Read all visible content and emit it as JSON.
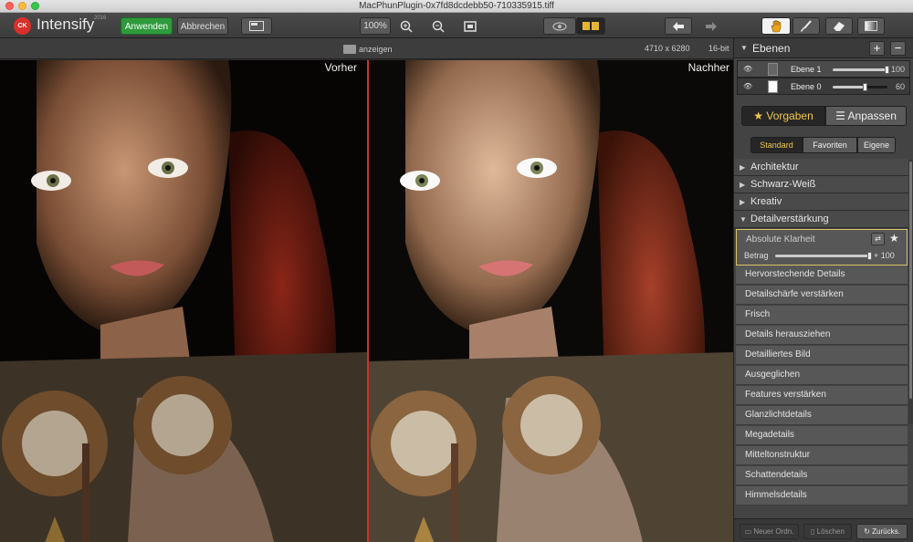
{
  "window": {
    "title": "MacPhunPlugin-0x7fd8dcdebb50-710335915.tiff"
  },
  "app": {
    "badge": "CK",
    "name": "Intensify",
    "year": "2016"
  },
  "toolbar": {
    "apply_label": "Anwenden",
    "cancel_label": "Abbrechen",
    "zoom_label": "100%"
  },
  "infobar": {
    "show_label": "anzeigen",
    "dimensions": "4710 x 6280",
    "bit_depth": "16-bit"
  },
  "preview": {
    "before_label": "Vorher",
    "after_label": "Nachher"
  },
  "layers": {
    "title": "Ebenen",
    "items": [
      {
        "name": "Ebene 1",
        "opacity": "100",
        "level": 1.0
      },
      {
        "name": "Ebene 0",
        "opacity": "60",
        "level": 0.6
      }
    ]
  },
  "tabs": {
    "presets": "Vorgaben",
    "adjust": "Anpassen"
  },
  "subtabs": {
    "standard": "Standard",
    "favorites": "Favoriten",
    "own": "Eigene"
  },
  "categories": [
    {
      "label": "Architektur",
      "expanded": false
    },
    {
      "label": "Schwarz-Weiß",
      "expanded": false
    },
    {
      "label": "Kreativ",
      "expanded": false
    },
    {
      "label": "Detailverstärkung",
      "expanded": true
    }
  ],
  "selected_preset": {
    "name": "Absolute Klarheit",
    "param_label": "Betrag",
    "param_value": "+ 100",
    "level": 1.0
  },
  "presets": [
    "Hervorstechende Details",
    "Detailschärfe verstärken",
    "Frisch",
    "Details herausziehen",
    "Detailliertes Bild",
    "Ausgeglichen",
    "Features verstärken",
    "Glanzlichtdetails",
    "Megadetails",
    "Mitteltonstruktur",
    "Schattendetails",
    "Himmelsdetails"
  ],
  "bottom": {
    "new_folder": "Neuer Ordn.",
    "delete": "Löschen",
    "back": "Zurücks."
  },
  "colors": {
    "apply_green": "#2f9a3c",
    "divider_red": "#c0392b",
    "accent_gold": "#f1c94a"
  }
}
